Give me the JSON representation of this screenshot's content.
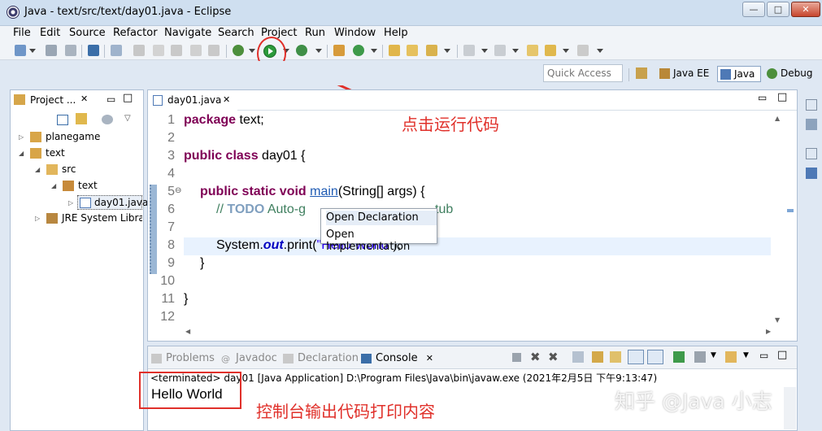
{
  "window": {
    "title": "Java - text/src/text/day01.java - Eclipse",
    "controls": [
      "—",
      "□",
      "✕"
    ]
  },
  "menu": [
    "File",
    "Edit",
    "Source",
    "Refactor",
    "Navigate",
    "Search",
    "Project",
    "Run",
    "Window",
    "Help"
  ],
  "quick_access": {
    "placeholder": "Quick Access"
  },
  "perspectives": [
    "Java EE",
    "Java",
    "Debug"
  ],
  "project_explorer": {
    "tab_label": "Project ...",
    "items": [
      {
        "label": "planegame",
        "icon": "project-icon",
        "expanded": false
      },
      {
        "label": "text",
        "icon": "project-icon",
        "expanded": true
      },
      {
        "label": "src",
        "icon": "source-folder-icon",
        "expanded": true
      },
      {
        "label": "text",
        "icon": "package-icon",
        "expanded": true
      },
      {
        "label": "day01.java",
        "icon": "java-file-icon",
        "expanded": false
      },
      {
        "label": "JRE System Libra",
        "icon": "library-icon",
        "expanded": false
      }
    ]
  },
  "editor": {
    "tab_label": "day01.java",
    "line_numbers": [
      "1",
      "2",
      "3",
      "4",
      "5",
      "6",
      "7",
      "8",
      "9",
      "10",
      "11",
      "12"
    ],
    "code": {
      "l1_kw": "package",
      "l1_rest": " text;",
      "l3_kw": "public class",
      "l3_rest": " day01 {",
      "l5_kw": "public static void",
      "l5_method": "main",
      "l5_rest": "(String[] args) {",
      "l6_comment": "// ",
      "l6_todo": "TODO",
      "l6_rest": " Auto-g",
      "l6_tail": "tub",
      "l8_start": "System.",
      "l8_field": "out",
      "l8_call": ".print(",
      "l8_str": "\"Hello World\"",
      "l8_end": ");",
      "l9": "}",
      "l11": "}"
    },
    "fold_marker": "⊖"
  },
  "context_popup": {
    "items": [
      "Open Declaration",
      "Open Implementation"
    ]
  },
  "console": {
    "tabs": [
      "Problems",
      "Javadoc",
      "Declaration",
      "Console"
    ],
    "status": "<terminated> day01 [Java Application] D:\\Program Files\\Java\\bin\\javaw.exe (2021年2月5日 下午9:13:47)",
    "output": "Hello World"
  },
  "annotations": {
    "run_hint": "点击运行代码",
    "console_hint": "控制台输出代码打印内容"
  },
  "watermark": "知乎 @Java 小志",
  "colors": {
    "highlight_red": "#e0302a",
    "keyword": "#7f0055",
    "comment": "#3f7f5f",
    "string": "#2a00ff"
  }
}
